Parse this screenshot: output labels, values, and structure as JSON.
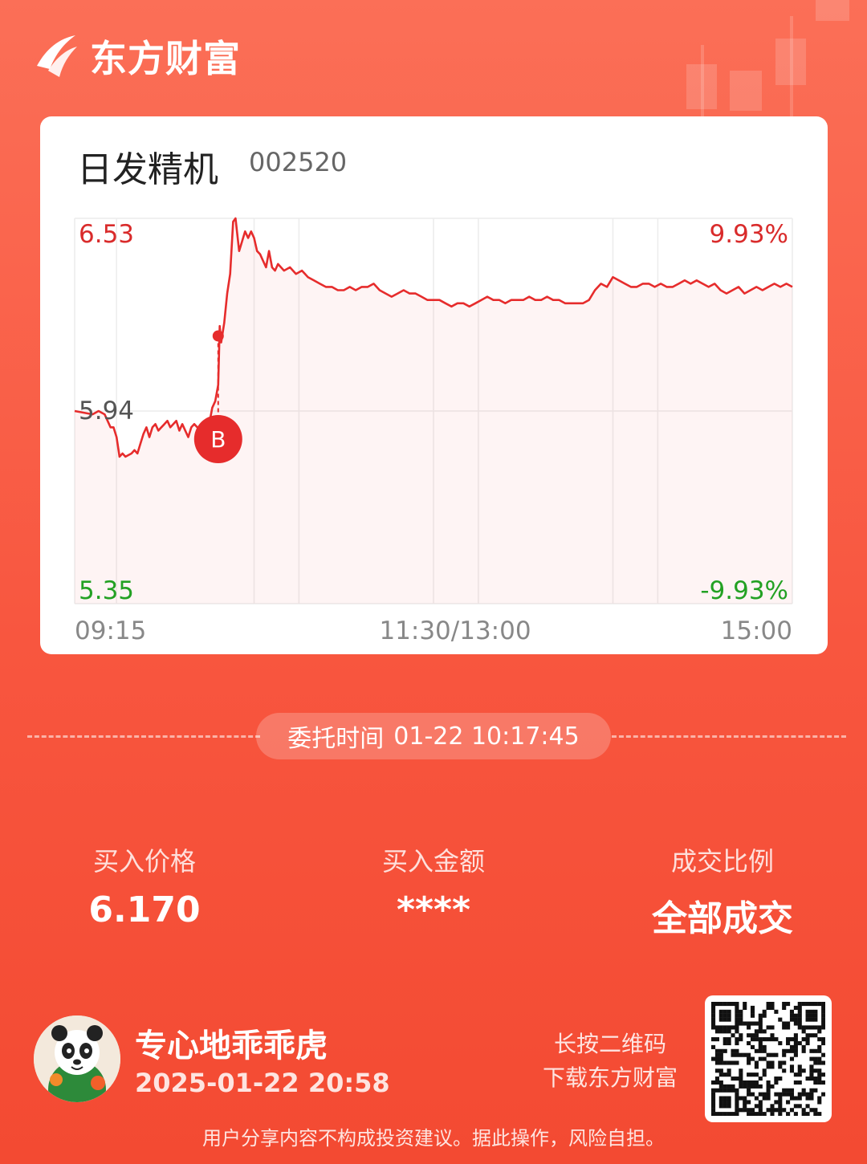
{
  "brand": {
    "name": "东方财富"
  },
  "stock": {
    "name": "日发精机",
    "code": "002520"
  },
  "chart_data": {
    "type": "line",
    "title": "",
    "price_high": "6.53",
    "price_mid": "5.94",
    "price_low": "5.35",
    "pct_high": "9.93%",
    "pct_low": "-9.93%",
    "x_labels": [
      "09:15",
      "11:30/13:00",
      "15:00"
    ],
    "ylim": [
      5.35,
      6.53
    ],
    "x_range_minutes": [
      0,
      240
    ],
    "buy_marker": {
      "label": "B",
      "minute": 48,
      "price": 6.17
    },
    "series": [
      {
        "points": [
          [
            0,
            5.94
          ],
          [
            6,
            5.93
          ],
          [
            8,
            5.94
          ],
          [
            10,
            5.93
          ],
          [
            11,
            5.91
          ],
          [
            12,
            5.89
          ],
          [
            13,
            5.89
          ],
          [
            14,
            5.86
          ],
          [
            15,
            5.8
          ],
          [
            16,
            5.81
          ],
          [
            17,
            5.8
          ],
          [
            19,
            5.81
          ],
          [
            20,
            5.82
          ],
          [
            21,
            5.81
          ],
          [
            22,
            5.84
          ],
          [
            23,
            5.87
          ],
          [
            24,
            5.89
          ],
          [
            25,
            5.86
          ],
          [
            26,
            5.89
          ],
          [
            27,
            5.9
          ],
          [
            28,
            5.88
          ],
          [
            29,
            5.89
          ],
          [
            30,
            5.9
          ],
          [
            31,
            5.91
          ],
          [
            32,
            5.89
          ],
          [
            33,
            5.9
          ],
          [
            34,
            5.91
          ],
          [
            35,
            5.88
          ],
          [
            36,
            5.9
          ],
          [
            37,
            5.88
          ],
          [
            38,
            5.86
          ],
          [
            39,
            5.89
          ],
          [
            40,
            5.9
          ],
          [
            41,
            5.89
          ],
          [
            42,
            5.89
          ],
          [
            43,
            5.89
          ],
          [
            44,
            5.89
          ],
          [
            45,
            5.9
          ],
          [
            46,
            5.95
          ],
          [
            47,
            5.97
          ],
          [
            48,
            6.02
          ],
          [
            48.5,
            6.2
          ],
          [
            49,
            6.15
          ],
          [
            50,
            6.21
          ],
          [
            51,
            6.3
          ],
          [
            52,
            6.36
          ],
          [
            53,
            6.52
          ],
          [
            53.8,
            6.53
          ],
          [
            55,
            6.43
          ],
          [
            56,
            6.46
          ],
          [
            57,
            6.49
          ],
          [
            58,
            6.47
          ],
          [
            59,
            6.49
          ],
          [
            60,
            6.47
          ],
          [
            61,
            6.43
          ],
          [
            62,
            6.42
          ],
          [
            63,
            6.4
          ],
          [
            64,
            6.38
          ],
          [
            65,
            6.43
          ],
          [
            66,
            6.38
          ],
          [
            67,
            6.37
          ],
          [
            68,
            6.39
          ],
          [
            70,
            6.37
          ],
          [
            72,
            6.38
          ],
          [
            74,
            6.36
          ],
          [
            76,
            6.37
          ],
          [
            78,
            6.35
          ],
          [
            80,
            6.34
          ],
          [
            82,
            6.33
          ],
          [
            84,
            6.32
          ],
          [
            86,
            6.32
          ],
          [
            88,
            6.31
          ],
          [
            90,
            6.31
          ],
          [
            92,
            6.32
          ],
          [
            94,
            6.31
          ],
          [
            96,
            6.32
          ],
          [
            98,
            6.32
          ],
          [
            100,
            6.33
          ],
          [
            102,
            6.31
          ],
          [
            104,
            6.3
          ],
          [
            106,
            6.29
          ],
          [
            108,
            6.3
          ],
          [
            110,
            6.31
          ],
          [
            112,
            6.3
          ],
          [
            114,
            6.3
          ],
          [
            116,
            6.29
          ],
          [
            118,
            6.28
          ],
          [
            120,
            6.28
          ],
          [
            122,
            6.28
          ],
          [
            124,
            6.27
          ],
          [
            126,
            6.26
          ],
          [
            128,
            6.27
          ],
          [
            130,
            6.27
          ],
          [
            132,
            6.26
          ],
          [
            134,
            6.27
          ],
          [
            136,
            6.28
          ],
          [
            138,
            6.29
          ],
          [
            140,
            6.28
          ],
          [
            142,
            6.28
          ],
          [
            144,
            6.27
          ],
          [
            146,
            6.28
          ],
          [
            148,
            6.28
          ],
          [
            150,
            6.28
          ],
          [
            152,
            6.29
          ],
          [
            154,
            6.28
          ],
          [
            156,
            6.28
          ],
          [
            158,
            6.29
          ],
          [
            160,
            6.28
          ],
          [
            162,
            6.28
          ],
          [
            164,
            6.27
          ],
          [
            166,
            6.27
          ],
          [
            168,
            6.27
          ],
          [
            170,
            6.27
          ],
          [
            172,
            6.28
          ],
          [
            174,
            6.31
          ],
          [
            176,
            6.33
          ],
          [
            178,
            6.32
          ],
          [
            180,
            6.35
          ],
          [
            182,
            6.34
          ],
          [
            184,
            6.33
          ],
          [
            186,
            6.32
          ],
          [
            188,
            6.32
          ],
          [
            190,
            6.33
          ],
          [
            192,
            6.33
          ],
          [
            194,
            6.32
          ],
          [
            196,
            6.33
          ],
          [
            198,
            6.32
          ],
          [
            200,
            6.32
          ],
          [
            202,
            6.33
          ],
          [
            204,
            6.34
          ],
          [
            206,
            6.33
          ],
          [
            208,
            6.34
          ],
          [
            210,
            6.33
          ],
          [
            212,
            6.32
          ],
          [
            214,
            6.33
          ],
          [
            216,
            6.31
          ],
          [
            218,
            6.3
          ],
          [
            220,
            6.31
          ],
          [
            222,
            6.32
          ],
          [
            224,
            6.3
          ],
          [
            226,
            6.31
          ],
          [
            228,
            6.32
          ],
          [
            230,
            6.31
          ],
          [
            232,
            6.32
          ],
          [
            234,
            6.33
          ],
          [
            236,
            6.32
          ],
          [
            238,
            6.33
          ],
          [
            240,
            6.32
          ]
        ]
      }
    ],
    "colors": {
      "line": "#e62c2c",
      "up_text": "#d92b2b",
      "down_text": "#23a123",
      "mid_text": "#555555",
      "axis_text": "#888888"
    }
  },
  "order": {
    "label": "委托时间",
    "time": "01-22 10:17:45"
  },
  "stats": [
    {
      "label": "买入价格",
      "value": "6.170"
    },
    {
      "label": "买入金额",
      "value": "****"
    },
    {
      "label": "成交比例",
      "value": "全部成交"
    }
  ],
  "user": {
    "name": "专心地乖乖虎",
    "time": "2025-01-22 20:58"
  },
  "qr": {
    "hint_line1": "长按二维码",
    "hint_line2": "下载东方财富"
  },
  "disclaimer": "用户分享内容不构成投资建议。据此操作，风险自担。"
}
